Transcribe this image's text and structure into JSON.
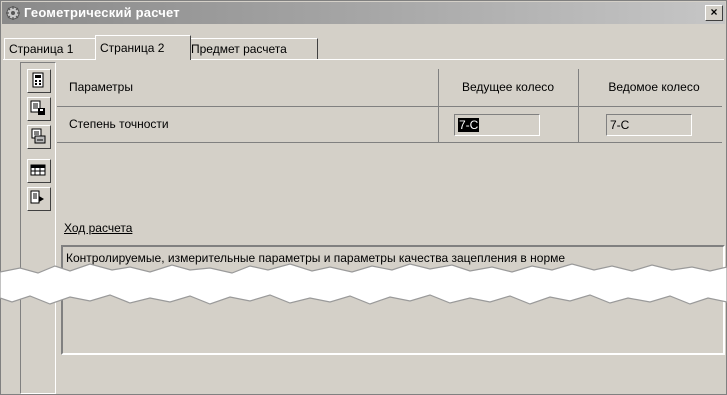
{
  "window": {
    "title": "Геометрический расчет",
    "close_glyph": "×"
  },
  "tabs": [
    {
      "label": "Страница 1",
      "active": false
    },
    {
      "label": "Страница 2",
      "active": true
    },
    {
      "label": "Предмет расчета",
      "active": false
    }
  ],
  "toolbar": {
    "icons": [
      "calculator-icon",
      "save-icon",
      "print-icon",
      "table-icon",
      "export-icon"
    ]
  },
  "params_table": {
    "headers": [
      "Параметры",
      "Ведущее колесо",
      "Ведомое колесо"
    ],
    "rows": [
      {
        "name": "Степень точности",
        "driving": "7-C",
        "driven": "7-C"
      }
    ]
  },
  "log": {
    "label": "Ход расчета",
    "text": "Контролируемые, измерительные параметры и параметры качества зацепления в норме"
  },
  "colors": {
    "face": "#d4d0c8",
    "title_gradient_start": "#8a8a8a",
    "shadow": "#808080"
  }
}
